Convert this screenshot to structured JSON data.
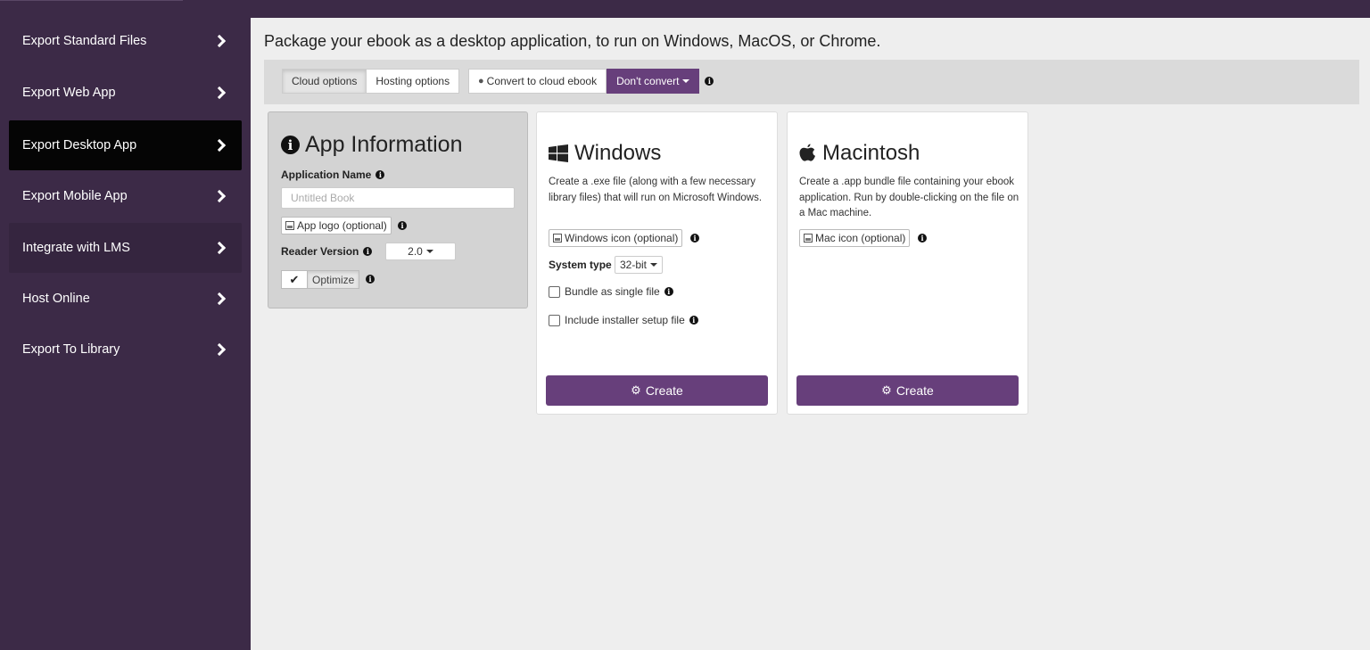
{
  "sidebar": {
    "items": [
      {
        "label": "Export Standard Files"
      },
      {
        "label": "Export Web App"
      },
      {
        "label": "Export Desktop App"
      },
      {
        "label": "Export Mobile App"
      },
      {
        "label": "Integrate with LMS"
      },
      {
        "label": "Host Online"
      },
      {
        "label": "Export To Library"
      }
    ]
  },
  "main": {
    "title": "Package your ebook as a desktop application, to run on Windows, MacOS, or Chrome.",
    "options": {
      "cloud_options": "Cloud options",
      "hosting_options": "Hosting options",
      "convert_cloud": "Convert to cloud ebook",
      "dont_convert": "Don't convert"
    },
    "app_info": {
      "title": "App Information",
      "app_name_label": "Application Name",
      "app_name_placeholder": "Untitled Book",
      "logo_button": "App logo (optional)",
      "reader_version_label": "Reader Version",
      "reader_version_value": "2.0",
      "optimize_label": "Optimize"
    },
    "windows": {
      "title": "Windows",
      "description": "Create a .exe file (along with a few necessary library files) that will run on Microsoft Windows.",
      "icon_button": "Windows icon (optional)",
      "system_type_label": "System type",
      "system_type_value": "32-bit",
      "bundle_label": "Bundle as single file",
      "installer_label": "Include installer setup file",
      "create_label": "Create"
    },
    "mac": {
      "title": "Macintosh",
      "description": "Create a .app bundle file containing your ebook application. Run by double-clicking on the file on a Mac machine.",
      "icon_button": "Mac icon (optional)",
      "create_label": "Create"
    }
  },
  "colors": {
    "sidebar_bg": "#3c2a47",
    "accent_purple": "#673f7b",
    "active_item_bg": "#050505",
    "main_bg": "#eeeeee"
  },
  "icons": {
    "chevron": "chevron-right-icon",
    "info": "info-circle-icon",
    "windows": "windows-logo-icon",
    "apple": "apple-logo-icon",
    "globe": "globe-icon",
    "image": "image-icon",
    "gear": "gear-icon",
    "check": "check-icon"
  }
}
